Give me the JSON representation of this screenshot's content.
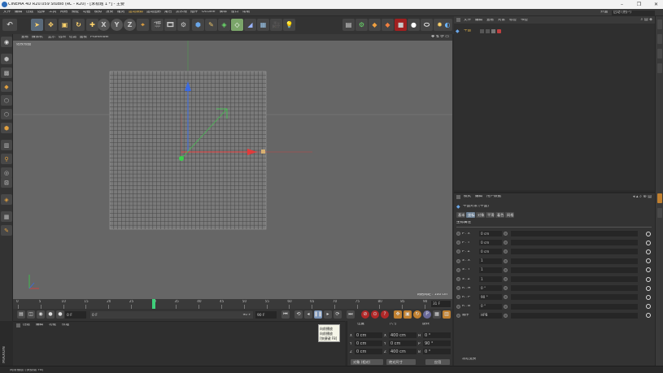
{
  "window": {
    "title": "CINEMA 4D R20.059 Studio (RC - R20) - [未标题 1 *] - 主要",
    "minimize": "–",
    "restore": "❐",
    "close": "✕"
  },
  "menubar": {
    "items": [
      "文件",
      "编辑",
      "创建",
      "选择",
      "工具",
      "网格",
      "捕捉",
      "动画",
      "模拟",
      "渲染",
      "雕刻",
      "运动跟踪",
      "运动图形",
      "角色",
      "流水线",
      "插件",
      "Octane",
      "脚本",
      "窗口",
      "帮助"
    ],
    "highlight_index": 11,
    "layout_label": "界面",
    "layout_value": "启动 (用户)"
  },
  "toolbar": {
    "undo_icon": "undo-icon",
    "axis_x": "X",
    "axis_y": "Y",
    "axis_z": "Z"
  },
  "viewport": {
    "menu": [
      "查看",
      "摄像机",
      "显示",
      "选项",
      "过滤",
      "面板",
      "ProRender"
    ],
    "camera_label": "透视视图",
    "grid_info": "网格间距 : 100 cm",
    "colors": {
      "background": "#666666",
      "plane": "#7b7b7b",
      "x_axis": "#e23b3b",
      "y_axis": "#3b6be2",
      "z_axis": "#3bd04a"
    }
  },
  "timeline": {
    "ticks": [
      "0",
      "5",
      "10",
      "15",
      "20",
      "25",
      "30",
      "35",
      "40",
      "45",
      "50",
      "55",
      "60",
      "65",
      "70",
      "75",
      "80",
      "85",
      "90"
    ],
    "current_frame": 30,
    "max_frame": 90,
    "frame_readout": "31 F"
  },
  "transport": {
    "start_field": "0 F",
    "left_field": "0 F",
    "right_field": "90 F",
    "end_field": "90 F"
  },
  "material_manager": {
    "menu": [
      "创建",
      "编辑",
      "功能",
      "纹理"
    ]
  },
  "tooltip": {
    "lines": [
      "向前播放",
      "向前播放",
      "[快捷键 F8]"
    ]
  },
  "coordinates": {
    "headers": [
      "位置",
      "尺寸",
      "旋转"
    ],
    "rows": [
      {
        "axis": "X",
        "pos": "0 cm",
        "size": "400 cm",
        "rot_axis": "H",
        "rot": "0 °"
      },
      {
        "axis": "Y",
        "pos": "0 cm",
        "size": "0 cm",
        "rot_axis": "P",
        "rot": "90 °"
      },
      {
        "axis": "Z",
        "pos": "0 cm",
        "size": "400 cm",
        "rot_axis": "B",
        "rot": "0 °"
      }
    ],
    "object_mode": "对象 (相对)",
    "size_mode": "绝对尺寸",
    "apply": "应用"
  },
  "status": {
    "text": "向前播放 [快捷键 F8]"
  },
  "object_manager": {
    "menu": [
      "文件",
      "编辑",
      "查看",
      "对象",
      "标签",
      "书签"
    ],
    "object_name": "平面"
  },
  "attributes": {
    "menu": [
      "模式",
      "编辑",
      "用户数据"
    ],
    "object_title": "平面对象 [平面]",
    "tabs": [
      "基本",
      "坐标",
      "对象",
      "平滑",
      "着色",
      "网格"
    ],
    "active_tab": 1,
    "section": "坐标属性",
    "rows": [
      {
        "label": "P . X",
        "value": "0 cm",
        "pct": ""
      },
      {
        "label": "P . Y",
        "value": "0 cm",
        "pct": ""
      },
      {
        "label": "P . Z",
        "value": "0 cm",
        "pct": ""
      },
      {
        "label": "S . X",
        "value": "1",
        "pct": ""
      },
      {
        "label": "S . Y",
        "value": "1",
        "pct": ""
      },
      {
        "label": "S . Z",
        "value": "1",
        "pct": ""
      },
      {
        "label": "R . H",
        "value": "0 °",
        "pct": ""
      },
      {
        "label": "R . P",
        "value": "90 °",
        "pct": ""
      },
      {
        "label": "R . B",
        "value": "0 °",
        "pct": ""
      },
      {
        "label": "顺序",
        "value": "HPB",
        "pct": ""
      }
    ],
    "footer": "冻结变换"
  }
}
